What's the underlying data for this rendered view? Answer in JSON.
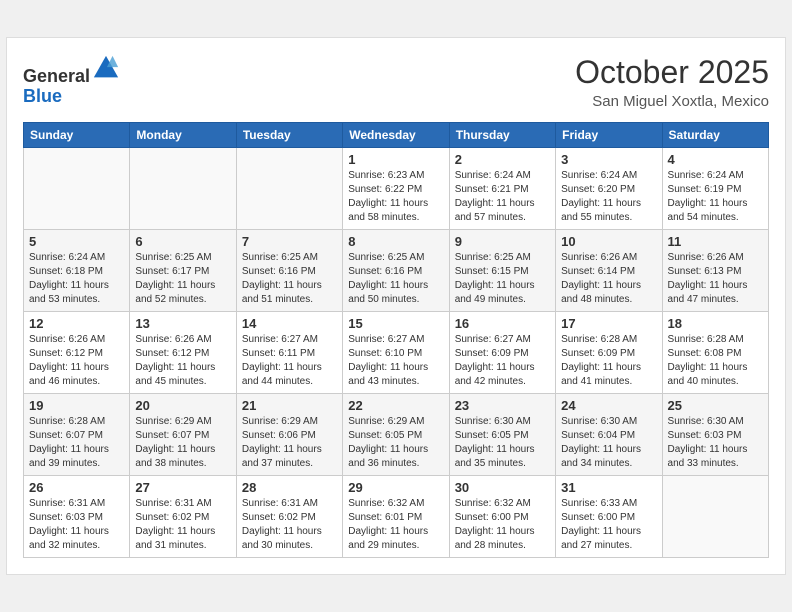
{
  "header": {
    "logo_line1": "General",
    "logo_line2": "Blue",
    "month": "October 2025",
    "location": "San Miguel Xoxtla, Mexico"
  },
  "days_of_week": [
    "Sunday",
    "Monday",
    "Tuesday",
    "Wednesday",
    "Thursday",
    "Friday",
    "Saturday"
  ],
  "weeks": [
    [
      {
        "day": "",
        "info": ""
      },
      {
        "day": "",
        "info": ""
      },
      {
        "day": "",
        "info": ""
      },
      {
        "day": "1",
        "info": "Sunrise: 6:23 AM\nSunset: 6:22 PM\nDaylight: 11 hours and 58 minutes."
      },
      {
        "day": "2",
        "info": "Sunrise: 6:24 AM\nSunset: 6:21 PM\nDaylight: 11 hours and 57 minutes."
      },
      {
        "day": "3",
        "info": "Sunrise: 6:24 AM\nSunset: 6:20 PM\nDaylight: 11 hours and 55 minutes."
      },
      {
        "day": "4",
        "info": "Sunrise: 6:24 AM\nSunset: 6:19 PM\nDaylight: 11 hours and 54 minutes."
      }
    ],
    [
      {
        "day": "5",
        "info": "Sunrise: 6:24 AM\nSunset: 6:18 PM\nDaylight: 11 hours and 53 minutes."
      },
      {
        "day": "6",
        "info": "Sunrise: 6:25 AM\nSunset: 6:17 PM\nDaylight: 11 hours and 52 minutes."
      },
      {
        "day": "7",
        "info": "Sunrise: 6:25 AM\nSunset: 6:16 PM\nDaylight: 11 hours and 51 minutes."
      },
      {
        "day": "8",
        "info": "Sunrise: 6:25 AM\nSunset: 6:16 PM\nDaylight: 11 hours and 50 minutes."
      },
      {
        "day": "9",
        "info": "Sunrise: 6:25 AM\nSunset: 6:15 PM\nDaylight: 11 hours and 49 minutes."
      },
      {
        "day": "10",
        "info": "Sunrise: 6:26 AM\nSunset: 6:14 PM\nDaylight: 11 hours and 48 minutes."
      },
      {
        "day": "11",
        "info": "Sunrise: 6:26 AM\nSunset: 6:13 PM\nDaylight: 11 hours and 47 minutes."
      }
    ],
    [
      {
        "day": "12",
        "info": "Sunrise: 6:26 AM\nSunset: 6:12 PM\nDaylight: 11 hours and 46 minutes."
      },
      {
        "day": "13",
        "info": "Sunrise: 6:26 AM\nSunset: 6:12 PM\nDaylight: 11 hours and 45 minutes."
      },
      {
        "day": "14",
        "info": "Sunrise: 6:27 AM\nSunset: 6:11 PM\nDaylight: 11 hours and 44 minutes."
      },
      {
        "day": "15",
        "info": "Sunrise: 6:27 AM\nSunset: 6:10 PM\nDaylight: 11 hours and 43 minutes."
      },
      {
        "day": "16",
        "info": "Sunrise: 6:27 AM\nSunset: 6:09 PM\nDaylight: 11 hours and 42 minutes."
      },
      {
        "day": "17",
        "info": "Sunrise: 6:28 AM\nSunset: 6:09 PM\nDaylight: 11 hours and 41 minutes."
      },
      {
        "day": "18",
        "info": "Sunrise: 6:28 AM\nSunset: 6:08 PM\nDaylight: 11 hours and 40 minutes."
      }
    ],
    [
      {
        "day": "19",
        "info": "Sunrise: 6:28 AM\nSunset: 6:07 PM\nDaylight: 11 hours and 39 minutes."
      },
      {
        "day": "20",
        "info": "Sunrise: 6:29 AM\nSunset: 6:07 PM\nDaylight: 11 hours and 38 minutes."
      },
      {
        "day": "21",
        "info": "Sunrise: 6:29 AM\nSunset: 6:06 PM\nDaylight: 11 hours and 37 minutes."
      },
      {
        "day": "22",
        "info": "Sunrise: 6:29 AM\nSunset: 6:05 PM\nDaylight: 11 hours and 36 minutes."
      },
      {
        "day": "23",
        "info": "Sunrise: 6:30 AM\nSunset: 6:05 PM\nDaylight: 11 hours and 35 minutes."
      },
      {
        "day": "24",
        "info": "Sunrise: 6:30 AM\nSunset: 6:04 PM\nDaylight: 11 hours and 34 minutes."
      },
      {
        "day": "25",
        "info": "Sunrise: 6:30 AM\nSunset: 6:03 PM\nDaylight: 11 hours and 33 minutes."
      }
    ],
    [
      {
        "day": "26",
        "info": "Sunrise: 6:31 AM\nSunset: 6:03 PM\nDaylight: 11 hours and 32 minutes."
      },
      {
        "day": "27",
        "info": "Sunrise: 6:31 AM\nSunset: 6:02 PM\nDaylight: 11 hours and 31 minutes."
      },
      {
        "day": "28",
        "info": "Sunrise: 6:31 AM\nSunset: 6:02 PM\nDaylight: 11 hours and 30 minutes."
      },
      {
        "day": "29",
        "info": "Sunrise: 6:32 AM\nSunset: 6:01 PM\nDaylight: 11 hours and 29 minutes."
      },
      {
        "day": "30",
        "info": "Sunrise: 6:32 AM\nSunset: 6:00 PM\nDaylight: 11 hours and 28 minutes."
      },
      {
        "day": "31",
        "info": "Sunrise: 6:33 AM\nSunset: 6:00 PM\nDaylight: 11 hours and 27 minutes."
      },
      {
        "day": "",
        "info": ""
      }
    ]
  ]
}
